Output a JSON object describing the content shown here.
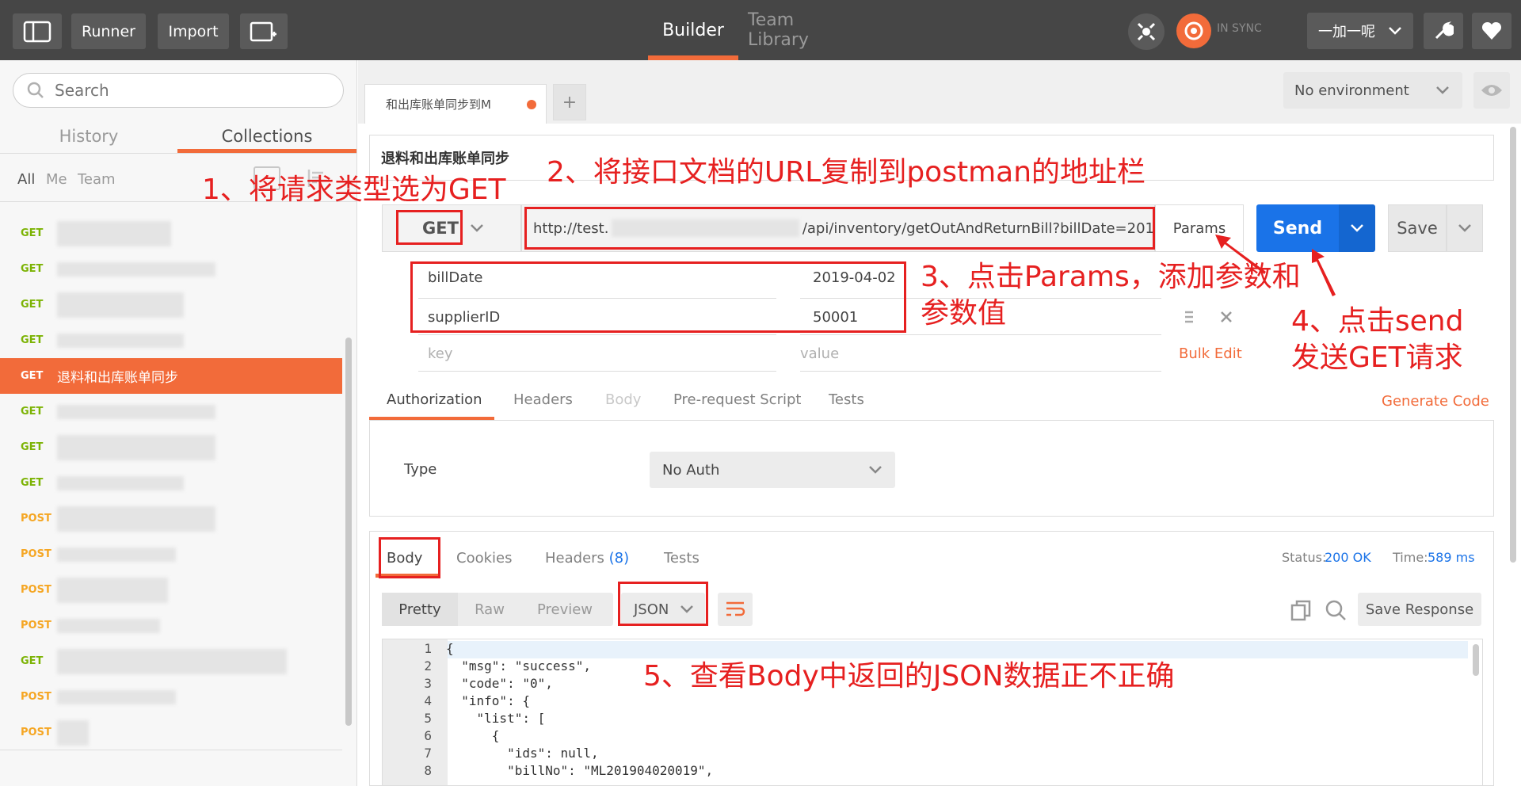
{
  "topbar": {
    "runner": "Runner",
    "import": "Import",
    "builder": "Builder",
    "team_library": "Team Library",
    "sync": "IN SYNC",
    "user": "一加一呢"
  },
  "sidebar": {
    "search_placeholder": "Search",
    "tab_history": "History",
    "tab_collections": "Collections",
    "filter_all": "All",
    "filter_me": "Me",
    "filter_team": "Team",
    "items": [
      {
        "method": "GET"
      },
      {
        "method": "GET"
      },
      {
        "method": "GET"
      },
      {
        "method": "GET"
      },
      {
        "method": "GET",
        "label": "退料和出库账单同步"
      },
      {
        "method": "GET"
      },
      {
        "method": "GET"
      },
      {
        "method": "GET"
      },
      {
        "method": "POST"
      },
      {
        "method": "POST"
      },
      {
        "method": "POST"
      },
      {
        "method": "POST"
      },
      {
        "method": "GET"
      },
      {
        "method": "POST"
      },
      {
        "method": "POST"
      }
    ]
  },
  "request_tab": {
    "label": "和出库账单同步到M",
    "add": "+"
  },
  "environment": {
    "selected": "No environment"
  },
  "request": {
    "name": "退料和出库账单同步",
    "method": "GET",
    "url": "http://test.",
    "url_tail": "/api/inventory/getOutAndReturnBill?billDate=201",
    "params_btn": "Params",
    "send": "Send",
    "save": "Save"
  },
  "params": {
    "rows": [
      {
        "key": "billDate",
        "value": "2019-04-02"
      },
      {
        "key": "supplierID",
        "value": "50001"
      }
    ],
    "key_placeholder": "key",
    "value_placeholder": "value",
    "bulk_edit": "Bulk Edit"
  },
  "req_tabs": {
    "authorization": "Authorization",
    "headers": "Headers",
    "body": "Body",
    "prerequest": "Pre-request Script",
    "tests": "Tests",
    "generate_code": "Generate Code"
  },
  "auth": {
    "type_label": "Type",
    "type_value": "No Auth"
  },
  "response": {
    "tab_body": "Body",
    "tab_cookies": "Cookies",
    "tab_headers": "Headers",
    "headers_count": "(8)",
    "tab_tests": "Tests",
    "status_label": "Status:",
    "status_value": "200 OK",
    "time_label": "Time:",
    "time_value": "589 ms",
    "view_pretty": "Pretty",
    "view_raw": "Raw",
    "view_preview": "Preview",
    "format": "JSON",
    "save_response": "Save Response",
    "code_lines": [
      {
        "n": "1",
        "text": "{"
      },
      {
        "n": "2",
        "text": "  \"msg\": \"success\","
      },
      {
        "n": "3",
        "text": "  \"code\": \"0\","
      },
      {
        "n": "4",
        "text": "  \"info\": {"
      },
      {
        "n": "5",
        "text": "    \"list\": ["
      },
      {
        "n": "6",
        "text": "      {"
      },
      {
        "n": "7",
        "text": "        \"ids\": null,"
      },
      {
        "n": "8",
        "text": "        \"billNo\": \"ML201904020019\","
      }
    ]
  },
  "annotations": {
    "a1": "1、将请求类型选为GET",
    "a2": "2、将接口文档的URL复制到postman的地址栏",
    "a3_line1": "3、点击Params，添加参数和",
    "a3_line2": "参数值",
    "a4_line1": "4、点击send",
    "a4_line2": "发送GET请求",
    "a5": "5、查看Body中返回的JSON数据正不正确"
  },
  "colors": {
    "accent": "#f26b3a",
    "send": "#1a73e8",
    "annotation": "#e62020",
    "get": "#7cb305",
    "post": "#f5a623"
  }
}
